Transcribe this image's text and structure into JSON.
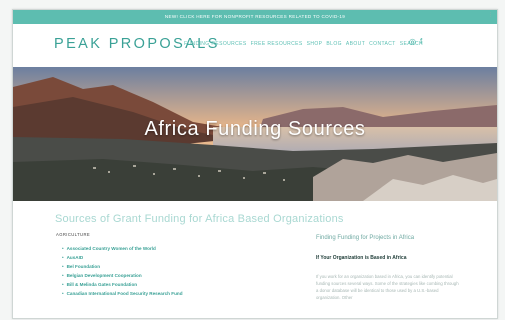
{
  "announcement": "NEW! CLICK HERE FOR NONPROFIT RESOURCES RELATED TO COVID-19",
  "logo": "PEAK PROPOSALS",
  "nav": [
    "FUNDING RESOURCES",
    "FREE RESOURCES",
    "SHOP",
    "BLOG",
    "ABOUT",
    "CONTACT",
    "SEARCH"
  ],
  "social": {
    "instagram": "◎",
    "facebook": "f"
  },
  "hero": {
    "title": "Africa Funding Sources"
  },
  "main": {
    "title": "Sources of Grant Funding for Africa Based Organizations",
    "category": "AGRICULTURE",
    "items": [
      "Associated Country Women of the World",
      "AusAID",
      "Bel Foundation",
      "Belgian Development Cooperation",
      "Bill & Melinda Gates Foundation",
      "Canadian International Food Security Research Fund"
    ]
  },
  "sidebar": {
    "title": "Finding Funding for Projects in Africa",
    "subtitle": "If Your Organization is Based in Africa",
    "text": "If you work for an organization based in Africa, you can identify potential funding sources several ways. Some of the strategies like combing through a donor database will be identical to those used by a U.S.-based organization. Other"
  },
  "colors": {
    "accent": "#5dbdb0",
    "brand": "#3aa196"
  }
}
